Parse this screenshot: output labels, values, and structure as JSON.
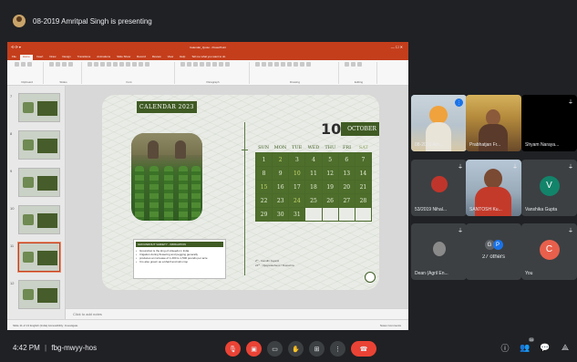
{
  "meet": {
    "presenting_text": "08-2019 Amritpal Singh is presenting",
    "time": "4:42 PM",
    "separator": "|",
    "meeting_code": "fbg-mwyy-hos",
    "people_count": "34"
  },
  "ppt": {
    "title": "Calendar_Quote - PowerPoint",
    "menu": [
      "File",
      "Home",
      "Insert",
      "Draw",
      "Design",
      "Transitions",
      "Animations",
      "Slide Show",
      "Record",
      "Review",
      "View",
      "Help",
      "Tell me what you want to do"
    ],
    "active_menu_index": 1,
    "ribbon_groups": [
      "Clipboard",
      "Slides",
      "Font",
      "Paragraph",
      "Drawing",
      "Editing"
    ],
    "notes_placeholder": "Click to add notes",
    "status_left": "Slide 11 of 13   English (India)   Accessibility: Investigate",
    "status_right": "Notes   Comments",
    "thumb_numbers": [
      "7",
      "8",
      "9",
      "10",
      "11",
      "12"
    ]
  },
  "slide": {
    "badge": "CALENDAR 2023",
    "day": "10",
    "month": "OCTOBER",
    "weekdays": [
      "SUN",
      "MON",
      "TUE",
      "WED",
      "THU",
      "FRI",
      "SAT"
    ],
    "days": [
      "1",
      "2",
      "3",
      "4",
      "5",
      "6",
      "7",
      "8",
      "9",
      "10",
      "11",
      "12",
      "13",
      "14",
      "15",
      "16",
      "17",
      "18",
      "19",
      "20",
      "21",
      "22",
      "23",
      "24",
      "25",
      "26",
      "27",
      "28",
      "29",
      "30",
      "31",
      "",
      "",
      "",
      ""
    ],
    "info_heading": "GROUNDNUT VARIETY - IRRIGATION",
    "info_lines": [
      "Groundnut is the king of oilseeds in India",
      "Irrigation during flowering and pegging generally",
      "produces an increase of 1,200 to 1,500 pounds per acre",
      "It is also grown as a kharif and rabi crop"
    ],
    "bottom_note_1": "2ᵗʰ - Gandhi Jayanti",
    "bottom_note_2": "24ᵗʰ - Vijayadashami / Dussehra"
  },
  "participants": [
    {
      "name": "08-2019 Am...",
      "type": "video",
      "speaking": true
    },
    {
      "name": "Prabhatjan Fr...",
      "type": "video",
      "speaking": false
    },
    {
      "name": "Shyam Naraya...",
      "type": "dark",
      "speaking": false
    },
    {
      "name": "53/2019 Nihal...",
      "type": "video",
      "speaking": false
    },
    {
      "name": "SANTOSH Ku...",
      "type": "video",
      "speaking": false
    },
    {
      "name": "Vanshika Gupta",
      "type": "letter",
      "letter": "V",
      "color": "#12846a"
    },
    {
      "name": "Dean (Agril En...",
      "type": "video",
      "speaking": false
    },
    {
      "name": "27 others",
      "type": "others"
    },
    {
      "name": "You",
      "type": "letter",
      "letter": "C",
      "color": "#e8604c"
    }
  ],
  "others_avatars": [
    "G",
    "P"
  ]
}
